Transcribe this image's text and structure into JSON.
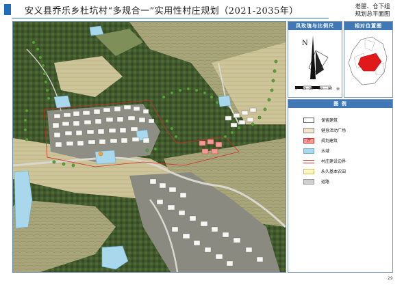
{
  "header": {
    "title": "安义县乔乐乡杜坑村“多规合一”实用性村庄规划（2021-2035年）",
    "subtitle_line1": "老屋、仓下组",
    "subtitle_line2": "规划总平面图"
  },
  "compass_panel": {
    "title": "风玫瑰与比例尺",
    "north_label": "N",
    "scale_ticks": [
      "0",
      "15",
      "30",
      "60",
      "90"
    ],
    "scale_unit": "米"
  },
  "location_panel": {
    "title": "相对位置图"
  },
  "legend": {
    "title": "图  例",
    "items": [
      {
        "label": "保留建筑",
        "swatch": "#ffffff",
        "border": "#555555"
      },
      {
        "label": "健身活动广场",
        "swatch": "#f2e6c9",
        "border": "#888888"
      },
      {
        "label": "规划建筑",
        "swatch": "#f19a9a",
        "border": "#c0392b",
        "sub": "2F"
      },
      {
        "label": "水域",
        "swatch": "#a9d8ec",
        "border": "#6aaed0"
      },
      {
        "label": "村庄建设边界",
        "swatch": "line-red",
        "border": "#d22b2b"
      },
      {
        "label": "永久基本农田",
        "swatch": "#fbf4c3",
        "border": "#cbbd5a"
      },
      {
        "label": "道路",
        "swatch": "#cfcfcf",
        "border": "#999999"
      }
    ]
  },
  "colors": {
    "accent": "#1f6fb8",
    "panel_header": "#3f78b5",
    "forest": "#3f5a2c",
    "field": "#c9bf8f",
    "water": "#a9d8ec",
    "planned": "#f19a9a"
  },
  "page": {
    "number": "29"
  }
}
